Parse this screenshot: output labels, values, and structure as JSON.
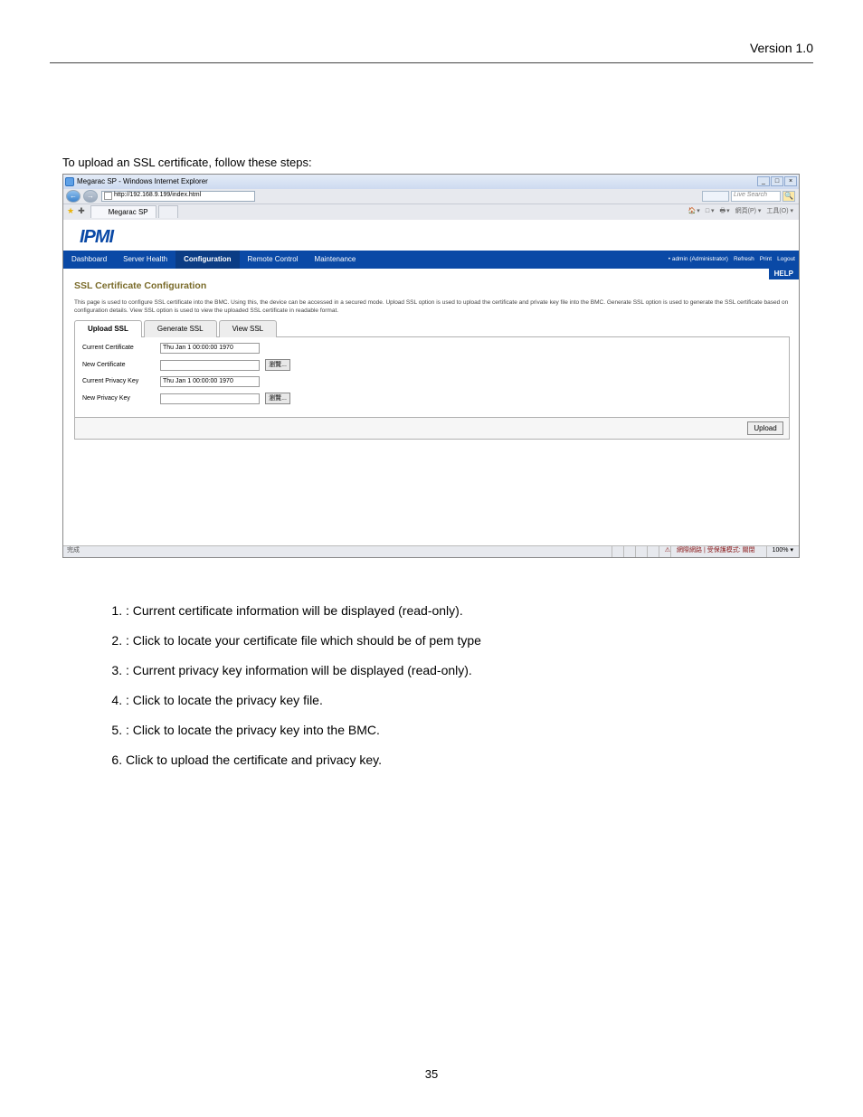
{
  "page": {
    "version": "Version 1.0",
    "number": "35"
  },
  "intro_text": "To upload an SSL certificate, follow these steps:",
  "screenshot": {
    "titlebar": {
      "text": "Megarac SP - Windows Internet Explorer",
      "minimize": "_",
      "maximize": "□",
      "close": "×"
    },
    "address": {
      "url": "http://192.168.9.199/index.html",
      "back": "←",
      "fwd": "→"
    },
    "search": {
      "placeholder": "Live Search",
      "go": "🔍"
    },
    "tabbar": {
      "active_tab": "Megarac SP",
      "tools": {
        "home": "▾",
        "feeds": "□ ▾",
        "print": "▾",
        "page": "網頁(P) ▾",
        "tools2": "工具(O) ▾"
      }
    },
    "logo": "IPMI",
    "menu": [
      {
        "label": "Dashboard",
        "sel": false
      },
      {
        "label": "Server Health",
        "sel": false
      },
      {
        "label": "Configuration",
        "sel": true
      },
      {
        "label": "Remote Control",
        "sel": false
      },
      {
        "label": "Maintenance",
        "sel": false
      }
    ],
    "userbar": {
      "user": "• admin (Administrator)",
      "refresh": "Refresh",
      "print": "Print",
      "logout": "Logout",
      "help": "HELP"
    },
    "panel": {
      "title": "SSL Certificate Configuration",
      "desc": "This page is used to configure SSL certificate into the BMC. Using this, the device can be accessed in a secured mode. Upload SSL option is used to upload the certificate and private key file into the BMC. Generate SSL option is used to generate the SSL certificate based on configuration details. View SSL option is used to view the uploaded SSL certificate in readable format."
    },
    "ssl_tabs": [
      {
        "label": "Upload SSL",
        "active": true
      },
      {
        "label": "Generate SSL",
        "active": false
      },
      {
        "label": "View SSL",
        "active": false
      }
    ],
    "fields": {
      "current_cert_label": "Current Certificate",
      "current_cert_value": "Thu Jan  1 00:00:00 1970",
      "new_cert_label": "New Certificate",
      "new_cert_value": "",
      "current_key_label": "Current Privacy Key",
      "current_key_value": "Thu Jan  1 00:00:00 1970",
      "new_key_label": "New Privacy Key",
      "new_key_value": "",
      "browse": "瀏覽..."
    },
    "upload_btn": "Upload",
    "status": {
      "done": "完成",
      "warn": "網際網路 | 受保護模式: 關閉",
      "zoom": "100%  ▾",
      "blank": "  "
    }
  },
  "steps": {
    "1": {
      "pre": "",
      "post": ": Current certificate information will be displayed (read-only)."
    },
    "2": {
      "pre": "",
      "post": ": Click to locate your certificate file which should be of pem type"
    },
    "3": {
      "pre": "",
      "post": ": Current privacy key information will be displayed (read-only)."
    },
    "4": {
      "pre": "",
      "post": ": Click to locate the privacy key file."
    },
    "5": {
      "pre": "",
      "post": ": Click to locate the privacy key into the BMC."
    },
    "6": {
      "pre": "Click ",
      "post": " to upload the certificate and privacy key."
    }
  }
}
